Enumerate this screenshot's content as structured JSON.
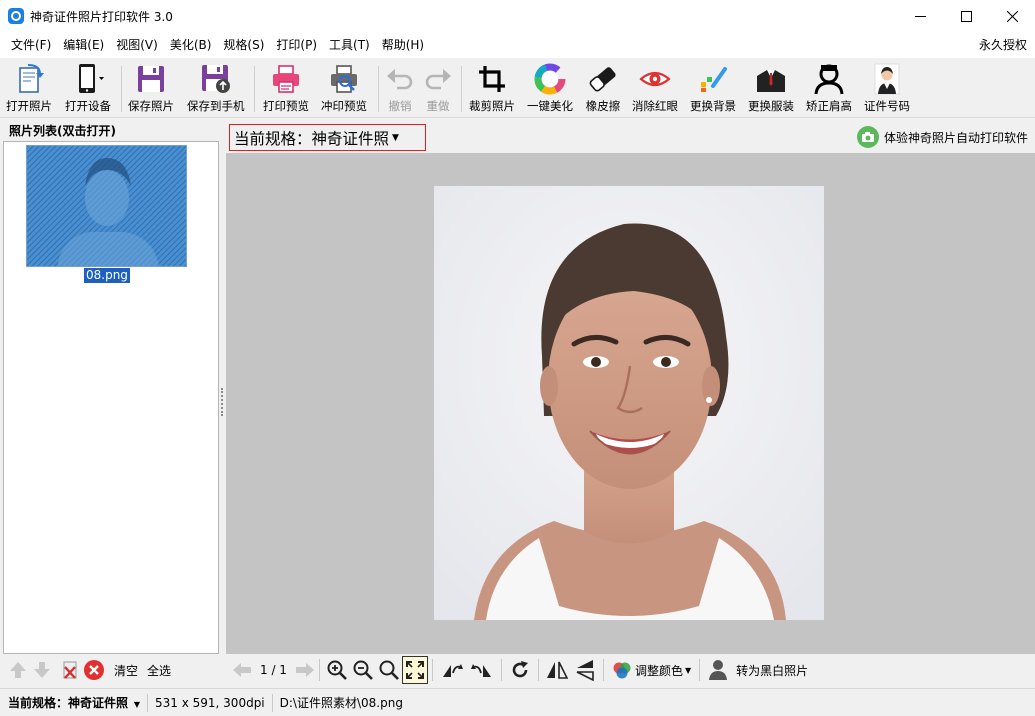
{
  "window": {
    "title": "神奇证件照片打印软件 3.0"
  },
  "menu": {
    "items": [
      "文件(F)",
      "编辑(E)",
      "视图(V)",
      "美化(B)",
      "规格(S)",
      "打印(P)",
      "工具(T)",
      "帮助(H)"
    ],
    "license": "永久授权"
  },
  "toolbar": {
    "open_photo": "打开照片",
    "open_device": "打开设备",
    "save_photo": "保存照片",
    "save_to_phone": "保存到手机",
    "print_preview": "打印预览",
    "develop_preview": "冲印预览",
    "undo": "撤销",
    "redo": "重做",
    "crop": "裁剪照片",
    "one_click_beautify": "一键美化",
    "eraser": "橡皮擦",
    "remove_red_eye": "消除红眼",
    "change_background": "更换背景",
    "change_clothes": "更换服装",
    "correct_shoulders": "矫正肩高",
    "id_number": "证件号码"
  },
  "left_panel": {
    "header": "照片列表(双击打开)",
    "thumbnail_name": "08.png",
    "clear": "清空",
    "select_all": "全选"
  },
  "main": {
    "spec_label": "当前规格：神奇证件照",
    "promo": "体验神奇照片自动打印软件"
  },
  "bottom_tools": {
    "page": "1 / 1",
    "adjust_color": "调整颜色",
    "to_grayscale": "转为黑白照片"
  },
  "status": {
    "spec": "当前规格：神奇证件照",
    "size": "531 x 591, 300dpi",
    "path": "D:\\证件照素材\\08.png"
  },
  "colors": {
    "accent_red": "#e02020",
    "selection_blue": "#1e5fbf",
    "canvas_gray": "#c4c4c4"
  }
}
